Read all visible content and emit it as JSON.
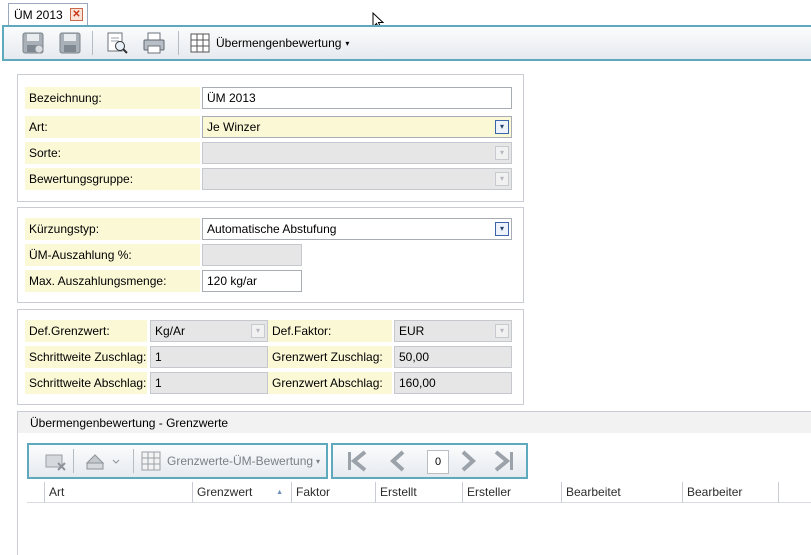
{
  "tab": {
    "label": "ÜM 2013",
    "close_glyph": "✕"
  },
  "toolbar": {
    "save_icon": "save-disk-icon",
    "save_close_icon": "save-close-disk-icon",
    "preview_icon": "print-preview-icon",
    "print_icon": "printer-icon",
    "view_menu": "Übermengenbewertung",
    "view_caret": "▾"
  },
  "section1": {
    "bezeichnung_label": "Bezeichnung:",
    "bezeichnung_value": "ÜM 2013",
    "art_label": "Art:",
    "art_value": "Je Winzer",
    "sorte_label": "Sorte:",
    "sorte_value": "",
    "bewertungsgruppe_label": "Bewertungsgruppe:",
    "bewertungsgruppe_value": ""
  },
  "section2": {
    "kuerzungstyp_label": "Kürzungstyp:",
    "kuerzungstyp_value": "Automatische Abstufung",
    "auszahlung_label": "ÜM-Auszahlung %:",
    "auszahlung_value": "",
    "maxmenge_label": "Max. Auszahlungsmenge:",
    "maxmenge_value": "120 kg/ar"
  },
  "section3": {
    "defgrenzwert_label": "Def.Grenzwert:",
    "defgrenzwert_value": "Kg/Ar",
    "deffaktor_label": "Def.Faktor:",
    "deffaktor_value": "EUR",
    "sw_zuschlag_label": "Schrittweite Zuschlag:",
    "sw_zuschlag_value": "1",
    "gw_zuschlag_label": "Grenzwert Zuschlag:",
    "gw_zuschlag_value": "50,00",
    "sw_abschlag_label": "Schrittweite Abschlag:",
    "sw_abschlag_value": "1",
    "gw_abschlag_label": "Grenzwert Abschlag:",
    "gw_abschlag_value": "160,00"
  },
  "grid": {
    "title": "Übermengenbewertung - Grenzwerte",
    "toolbar_menu": "Grenzwerte-ÜM-Bewertung",
    "page_number": "0",
    "columns": [
      "Art",
      "Grenzwert",
      "Faktor",
      "Erstellt",
      "Ersteller",
      "Bearbeitet",
      "Bearbeiter"
    ],
    "sort_glyph": "▲"
  },
  "dropdown_glyph": "▾"
}
